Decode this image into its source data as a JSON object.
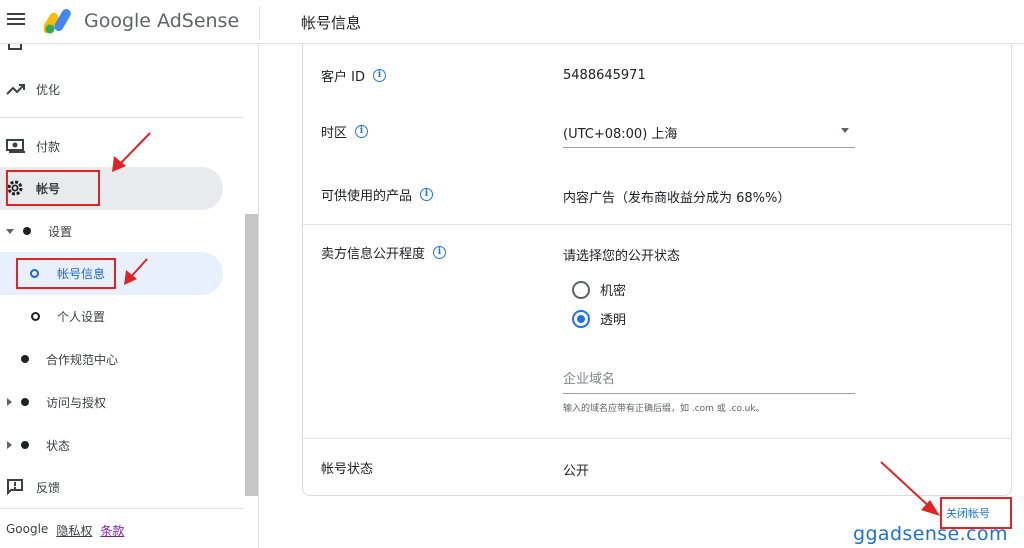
{
  "app": {
    "brand": "Google AdSense",
    "page_title": "帐号信息"
  },
  "sidebar": {
    "items": [
      {
        "label": "优化",
        "icon": "trending-up-icon"
      },
      {
        "label": "付款",
        "icon": "payments-icon"
      },
      {
        "label": "帐号",
        "icon": "gear-icon"
      },
      {
        "label": "设置"
      },
      {
        "label": "帐号信息"
      },
      {
        "label": "个人设置"
      },
      {
        "label": "合作规范中心"
      },
      {
        "label": "访问与授权"
      },
      {
        "label": "状态"
      },
      {
        "label": "反馈",
        "icon": "feedback-icon"
      }
    ],
    "footer": {
      "google": "Google",
      "privacy": "隐私权",
      "terms": "条款"
    }
  },
  "account": {
    "customer_id": {
      "label": "客户 ID",
      "value": "5488645971"
    },
    "timezone": {
      "label": "时区",
      "value": "(UTC+08:00) 上海"
    },
    "products": {
      "label": "可供使用的产品",
      "value": "内容广告（发布商收益分成为 68%%）"
    },
    "seller": {
      "label": "卖方信息公开程度",
      "prompt": "请选择您的公开状态",
      "options": [
        {
          "label": "机密",
          "selected": false
        },
        {
          "label": "透明",
          "selected": true
        }
      ],
      "domain_placeholder": "企业域名",
      "domain_hint": "输入的域名应带有正确后缀，如 .com 或 .co.uk。"
    },
    "status": {
      "label": "帐号状态",
      "value": "公开"
    },
    "close_link": "关闭帐号"
  },
  "watermark": "ggadsense.com",
  "colors": {
    "accent": "#1a73e8",
    "annotation_red": "#e02424",
    "selected_bg": "#e8eaed",
    "active_bg": "#e8f0fe"
  }
}
